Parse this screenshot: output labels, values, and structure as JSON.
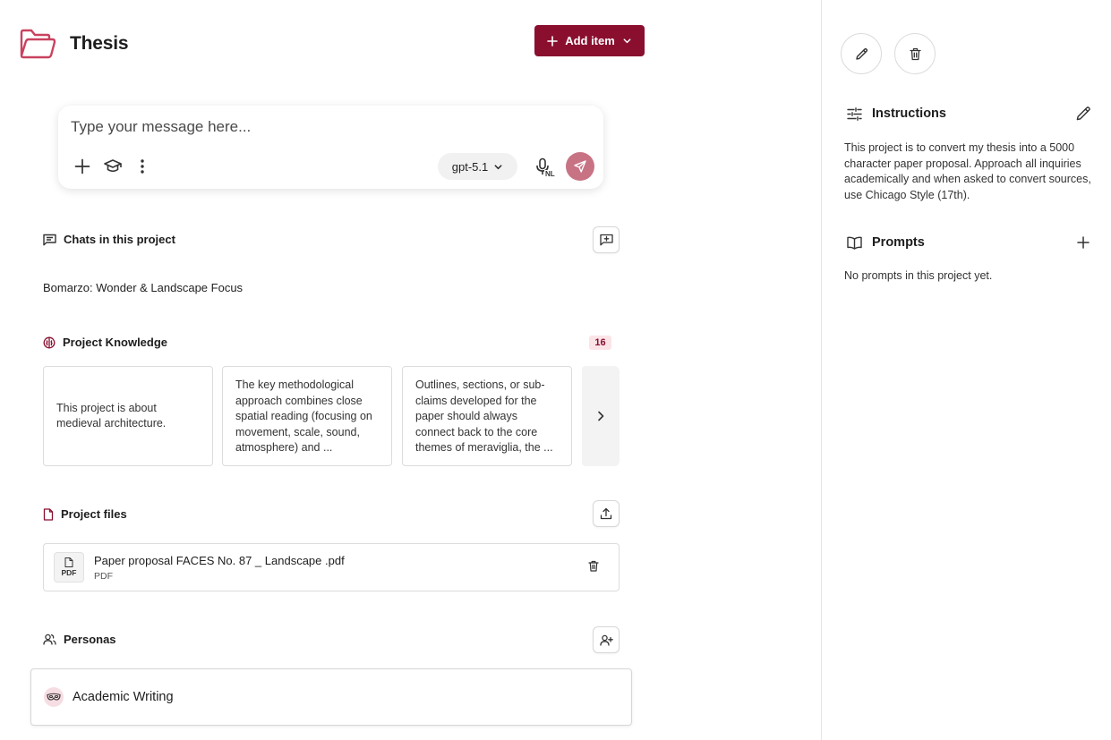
{
  "header": {
    "title": "Thesis",
    "add_item_label": "Add item"
  },
  "composer": {
    "placeholder": "Type your message here...",
    "model": "gpt-5.1",
    "language_badge": "NL"
  },
  "chats": {
    "heading": "Chats in this project",
    "items": [
      {
        "title": "Bomarzo: Wonder & Landscape Focus"
      }
    ]
  },
  "knowledge": {
    "heading": "Project Knowledge",
    "count": "16",
    "cards": [
      {
        "text": "This project is about medieval architecture."
      },
      {
        "text": "The key methodological approach combines close spatial reading (focusing on movement, scale, sound, atmosphere) and ..."
      },
      {
        "text": "Outlines, sections, or sub-claims developed for the paper should always connect back to the core themes of meraviglia, the ..."
      }
    ]
  },
  "files": {
    "heading": "Project files",
    "items": [
      {
        "name": "Paper proposal FACES No. 87 _ Landscape .pdf",
        "type": "PDF",
        "icon_label": "PDF"
      }
    ]
  },
  "personas": {
    "heading": "Personas",
    "items": [
      {
        "name": "Academic Writing"
      }
    ]
  },
  "right_panel": {
    "instructions_heading": "Instructions",
    "instructions_text": "This project is to convert my thesis into a 5000 character paper proposal. Approach all inquiries academically and when asked to convert sources, use Chicago Style (17th).",
    "prompts_heading": "Prompts",
    "prompts_empty": "No prompts in this project yet."
  },
  "colors": {
    "brand": "#8a0f2f",
    "send_button": "#c87384",
    "folder_icon": "#c9425f",
    "badge_bg": "#fbe4e8"
  }
}
